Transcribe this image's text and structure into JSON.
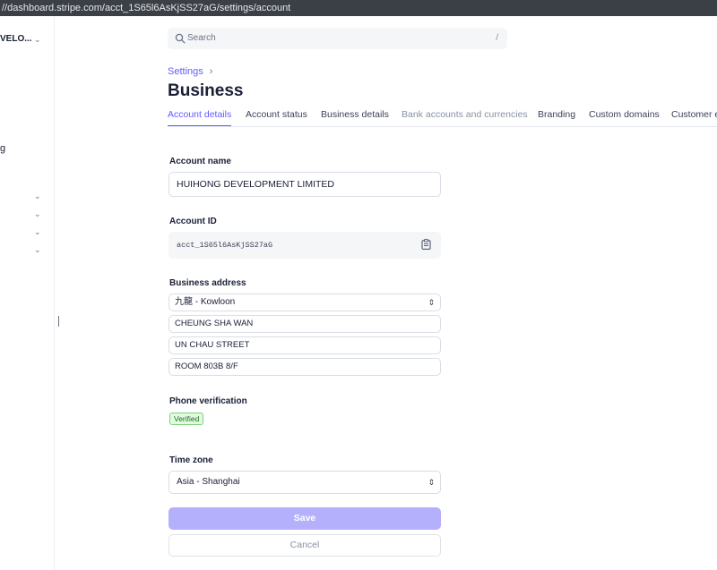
{
  "browser": {
    "url": "//dashboard.stripe.com/acct_1S65l6AsKjSS27aG/settings/account"
  },
  "sidebar": {
    "account_name": "VELO...",
    "fragment_text": "g",
    "chevrons": [
      "⌄",
      "⌄",
      "⌄",
      "⌄"
    ]
  },
  "search": {
    "placeholder": "Search",
    "shortcut": "/"
  },
  "breadcrumb": {
    "label": "Settings",
    "separator": "›"
  },
  "page": {
    "title": "Business"
  },
  "tabs": [
    {
      "label": "Account details",
      "state": "active"
    },
    {
      "label": "Account status",
      "state": "normal"
    },
    {
      "label": "Business details",
      "state": "normal"
    },
    {
      "label": "Bank accounts and currencies",
      "state": "muted"
    },
    {
      "label": "Branding",
      "state": "normal"
    },
    {
      "label": "Custom domains",
      "state": "normal"
    },
    {
      "label": "Customer e",
      "state": "normal"
    }
  ],
  "form": {
    "account_name_label": "Account name",
    "account_name_value": "HUIHONG DEVELOPMENT LIMITED",
    "account_id_label": "Account ID",
    "account_id_value": "acct_1S65l6AsKjSS27aG",
    "address_label": "Business address",
    "address_region": "九龍 - Kowloon",
    "address_line1": "CHEUNG SHA WAN",
    "address_line2": "UN CHAU STREET",
    "address_line3": "ROOM 803B 8/F",
    "phone_label": "Phone verification",
    "phone_badge": "Verified",
    "timezone_label": "Time zone",
    "timezone_value": "Asia - Shanghai"
  },
  "actions": {
    "save_label": "Save",
    "cancel_label": "Cancel"
  },
  "colors": {
    "accent": "#635bff",
    "save_disabled": "#b4b0fb",
    "verified_bg": "#e2fbe0",
    "verified_border": "#7bd27b"
  },
  "icons": {
    "search": "search-icon",
    "clipboard": "clipboard-icon",
    "select": "chevron-updown-icon"
  }
}
